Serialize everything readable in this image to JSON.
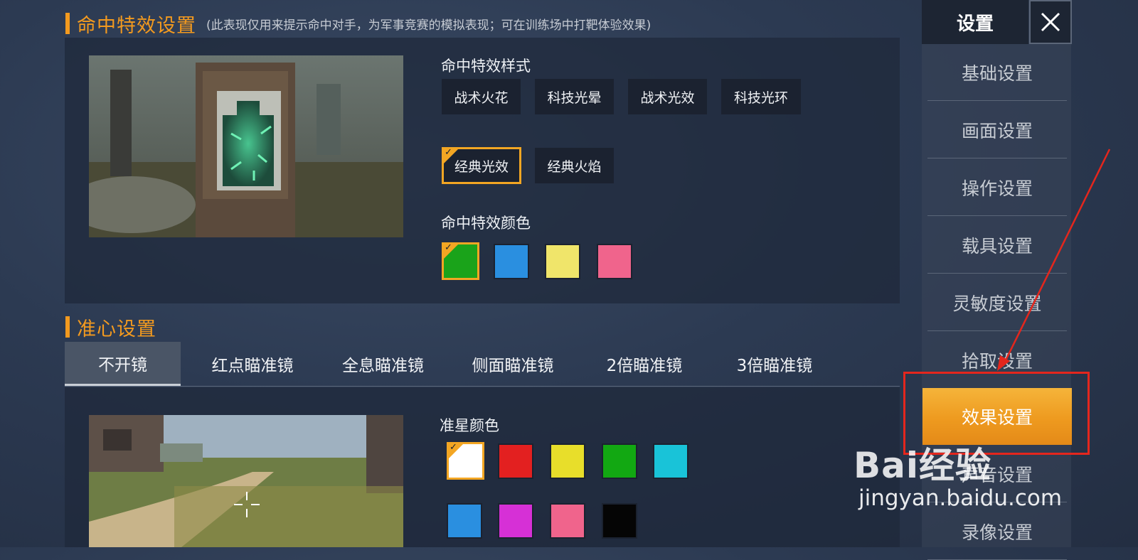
{
  "hit_effect": {
    "title": "命中特效设置",
    "note": "(此表现仅用来提示命中对手，为军事竞赛的模拟表现；可在训练场中打靶体验效果)",
    "style_label": "命中特效样式",
    "styles": [
      "战术火花",
      "科技光晕",
      "战术光效",
      "科技光环",
      "经典光效",
      "经典火焰"
    ],
    "selected_style": "经典光效",
    "color_label": "命中特效颜色",
    "colors": [
      "#1aa31a",
      "#2a8fe0",
      "#f0e56a",
      "#f0648c"
    ]
  },
  "crosshair": {
    "title": "准心设置",
    "tabs": [
      "不开镜",
      "红点瞄准镜",
      "全息瞄准镜",
      "侧面瞄准镜",
      "2倍瞄准镜",
      "3倍瞄准镜"
    ],
    "active_tab": "不开镜",
    "color_label": "准星颜色",
    "colors": [
      "#ffffff",
      "#e32020",
      "#e8de2a",
      "#12a812",
      "#19c3d8",
      "#2a8fe0",
      "#d630d6",
      "#f0648c",
      "#050505"
    ]
  },
  "sidebar": {
    "title": "设置",
    "items": [
      "基础设置",
      "画面设置",
      "操作设置",
      "载具设置",
      "灵敏度设置",
      "拾取设置",
      "效果设置",
      "声音设置",
      "录像设置"
    ],
    "active": "效果设置"
  },
  "watermark": {
    "brand": "Bai经验",
    "url": "jingyan.baidu.com"
  },
  "colors": {
    "accent": "#f39a1f",
    "annotation": "#e4261d"
  }
}
